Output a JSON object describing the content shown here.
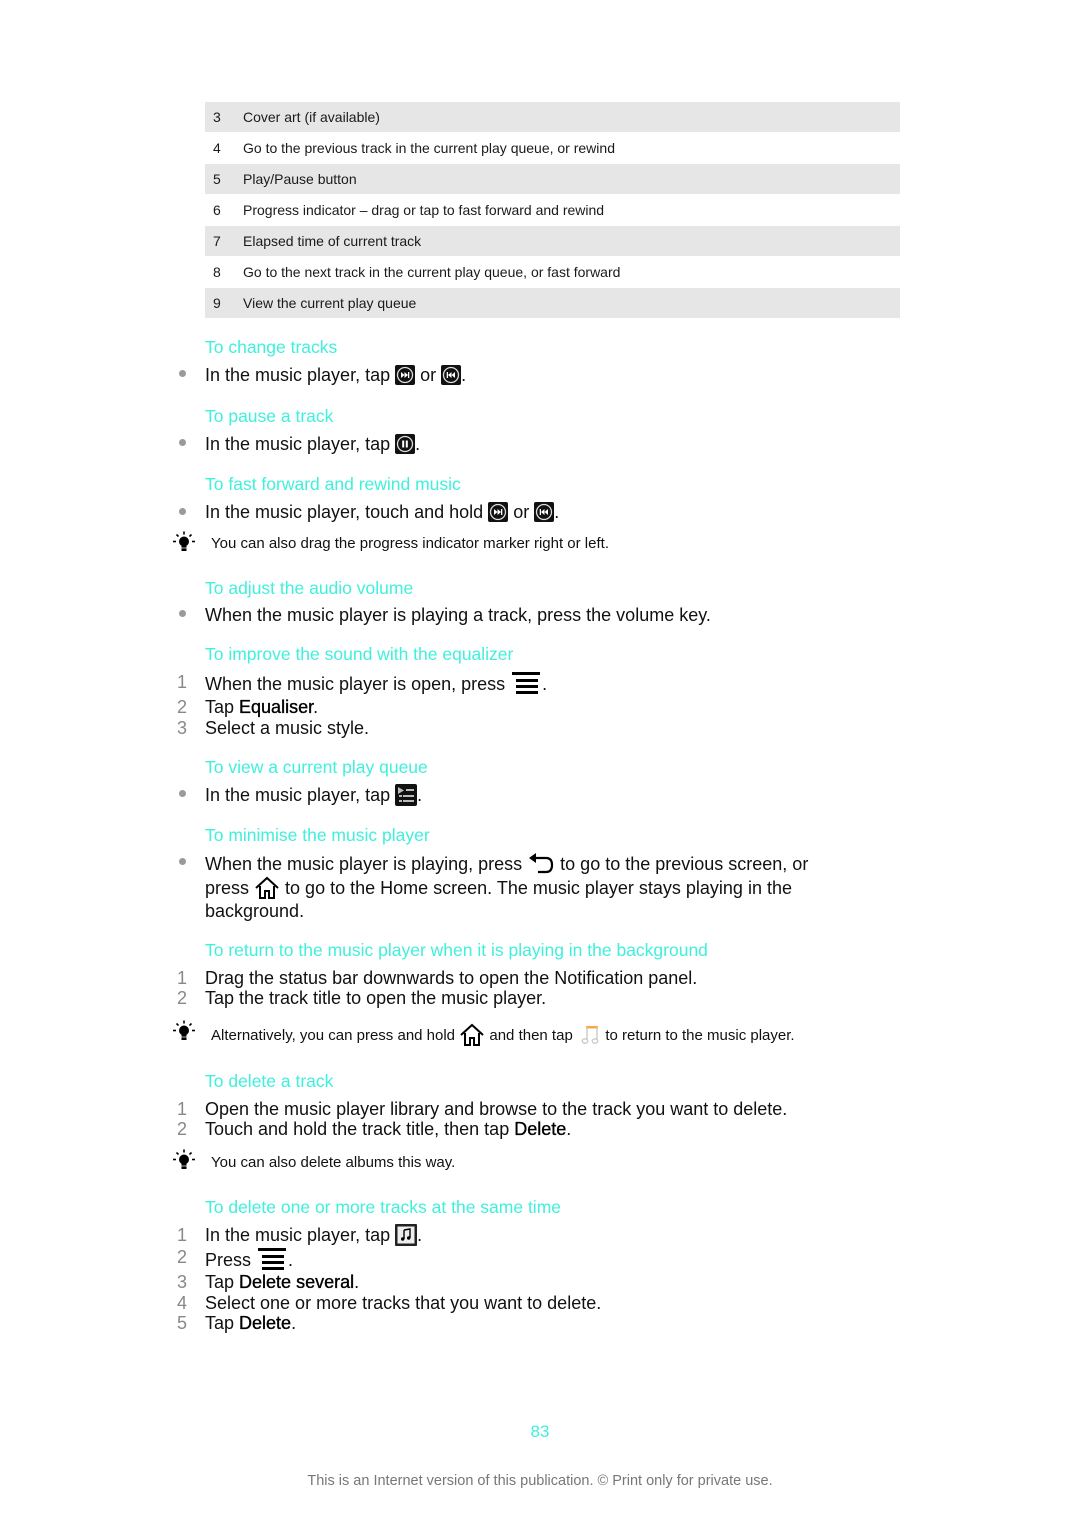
{
  "legend_table": {
    "rows": [
      {
        "num": "3",
        "text": "Cover art (if available)"
      },
      {
        "num": "4",
        "text": "Go to the previous track in the current play queue, or rewind"
      },
      {
        "num": "5",
        "text": "Play/Pause button"
      },
      {
        "num": "6",
        "text": "Progress indicator – drag or tap to fast forward and rewind"
      },
      {
        "num": "7",
        "text": "Elapsed time of current track"
      },
      {
        "num": "8",
        "text": "Go to the next track in the current play queue, or fast forward"
      },
      {
        "num": "9",
        "text": "View the current play queue"
      }
    ]
  },
  "sections": {
    "change_tracks": {
      "heading": "To change tracks",
      "step_pre": "In the music player, tap",
      "step_mid": "or",
      "step_post": "."
    },
    "pause_track": {
      "heading": "To pause a track",
      "step_pre": "In the music player, tap",
      "step_post": "."
    },
    "fast_forward": {
      "heading": "To fast forward and rewind music",
      "step_pre": "In the music player, touch and hold",
      "step_mid": "or",
      "step_post": ".",
      "tip": "You can also drag the progress indicator marker right or left."
    },
    "adjust_volume": {
      "heading": "To adjust the audio volume",
      "step": "When the music player is playing a track, press the volume key."
    },
    "equalizer": {
      "heading": "To improve the sound with the equalizer",
      "steps": [
        {
          "num": "1",
          "pre": "When the music player is open, press",
          "post": "."
        },
        {
          "num": "2",
          "pre": "Tap ",
          "bold": "Equaliser",
          "post": "."
        },
        {
          "num": "3",
          "pre": "Select a music style."
        }
      ]
    },
    "view_queue": {
      "heading": "To view a current play queue",
      "step_pre": "In the music player, tap",
      "step_post": "."
    },
    "minimise": {
      "heading": "To minimise the music player",
      "line1_pre": "When the music player is playing, press",
      "line1_post": "to go to the previous screen, or",
      "line2_pre": "press",
      "line2_post": "to go to the Home screen. The music player stays playing in the",
      "line3": "background."
    },
    "return_player": {
      "heading": "To return to the music player when it is playing in the background",
      "steps": [
        {
          "num": "1",
          "text": "Drag the status bar downwards to open the Notification panel."
        },
        {
          "num": "2",
          "text": "Tap the track title to open the music player."
        }
      ],
      "tip_pre": "Alternatively, you can press and hold",
      "tip_mid": "and then tap",
      "tip_post": "to return to the music player."
    },
    "delete_track": {
      "heading": "To delete a track",
      "steps": [
        {
          "num": "1",
          "pre": "Open the music player library and browse to the track you want to delete."
        },
        {
          "num": "2",
          "pre": "Touch and hold the track title, then tap ",
          "bold": "Delete",
          "post": "."
        }
      ],
      "tip": "You can also delete albums this way."
    },
    "delete_several": {
      "heading": "To delete one or more tracks at the same time",
      "steps": [
        {
          "num": "1",
          "pre": "In the music player, tap",
          "post": "."
        },
        {
          "num": "2",
          "pre": "Press",
          "post": "."
        },
        {
          "num": "3",
          "pre": "Tap ",
          "bold": "Delete several",
          "post": "."
        },
        {
          "num": "4",
          "pre": "Select one or more tracks that you want to delete."
        },
        {
          "num": "5",
          "pre": "Tap ",
          "bold": "Delete",
          "post": "."
        }
      ]
    }
  },
  "icons": {
    "next": "fast-forward-icon",
    "previous": "rewind-icon",
    "pause": "pause-icon",
    "menu": "menu-icon",
    "queue": "play-queue-icon",
    "back": "back-icon",
    "home": "home-icon",
    "music": "music-note-icon",
    "library": "music-library-icon",
    "tip": "lightbulb-icon"
  },
  "colors": {
    "heading": "#40f0dc",
    "table_shade": "#e6e6e6",
    "footer": "#777777"
  },
  "page_number": "83",
  "footer": "This is an Internet version of this publication. © Print only for private use."
}
